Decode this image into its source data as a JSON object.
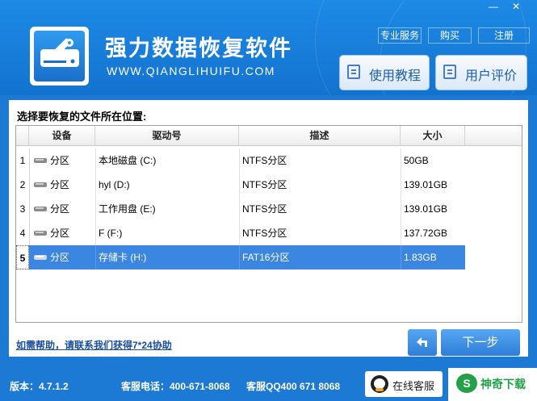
{
  "window_controls": {
    "minimize": "—",
    "close": "✕"
  },
  "header": {
    "title": "强力数据恢复软件",
    "url": "WWW.QIANGLIHUIFU.COM",
    "links": [
      "专业服务",
      "购买",
      "注册"
    ],
    "tutorial_button": "使用教程",
    "review_button": "用户评价"
  },
  "main": {
    "prompt": "选择要恢复的文件所在位置:",
    "columns": [
      "设备",
      "驱动号",
      "描述",
      "大小"
    ],
    "rows": [
      {
        "num": "1",
        "device": "分区",
        "drive": "本地磁盘 (C:)",
        "desc": "NTFS分区",
        "size": "50GB"
      },
      {
        "num": "2",
        "device": "分区",
        "drive": "hyl (D:)",
        "desc": "NTFS分区",
        "size": "139.01GB"
      },
      {
        "num": "3",
        "device": "分区",
        "drive": "工作用盘 (E:)",
        "desc": "NTFS分区",
        "size": "139.01GB"
      },
      {
        "num": "4",
        "device": "分区",
        "drive": "F (F:)",
        "desc": "NTFS分区",
        "size": "137.72GB"
      },
      {
        "num": "5",
        "device": "分区",
        "drive": "存储卡 (H:)",
        "desc": "FAT16分区",
        "size": "1.83GB"
      }
    ],
    "selected_row": 5,
    "help_link": "如需帮助，请联系我们获得7*24协助",
    "back_icon": "undo-arrow-icon",
    "next_button": "下一步"
  },
  "footer": {
    "version": "版本：4.7.1.2",
    "service_phone": "客服电话：400-671-8068",
    "service_qq": "客服QQ400 671 8068",
    "online_service": "在线客服",
    "brand": "神奇下载"
  },
  "colors": {
    "primary_blue": "#1c79d4",
    "selection": "#3a86e0",
    "brand_green": "#24a148"
  }
}
